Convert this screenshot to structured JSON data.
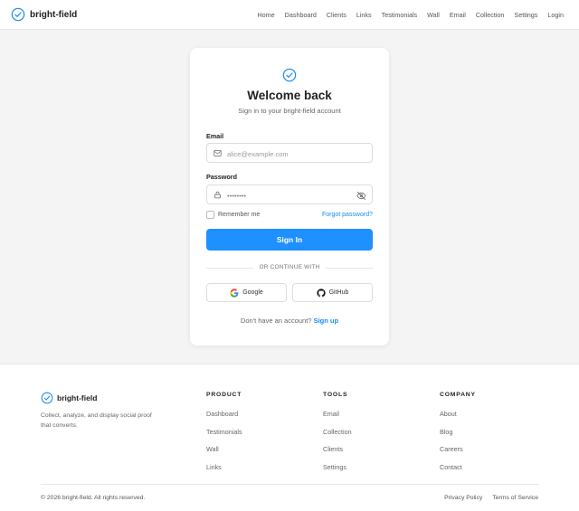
{
  "header": {
    "brand": "bright-field",
    "nav": [
      "Home",
      "Dashboard",
      "Clients",
      "Links",
      "Testimonials",
      "Wall",
      "Email",
      "Collection",
      "Settings",
      "Login"
    ]
  },
  "login": {
    "title": "Welcome back",
    "subtitle": "Sign in to your bright-field account",
    "email_label": "Email",
    "email_placeholder": "alice@example.com",
    "password_label": "Password",
    "password_value": "••••••••",
    "remember": "Remember me",
    "forgot": "Forgot password?",
    "submit": "Sign In",
    "divider": "OR CONTINUE WITH",
    "google": "Google",
    "github": "GitHub",
    "no_account": "Don't have an account?",
    "signup": "Sign up"
  },
  "footer": {
    "brand": "bright-field",
    "tagline": "Collect, analyze, and display social proof that converts.",
    "columns": [
      {
        "title": "PRODUCT",
        "links": [
          "Dashboard",
          "Testimonials",
          "Wall",
          "Links"
        ]
      },
      {
        "title": "TOOLS",
        "links": [
          "Email",
          "Collection",
          "Clients",
          "Settings"
        ]
      },
      {
        "title": "COMPANY",
        "links": [
          "About",
          "Blog",
          "Careers",
          "Contact"
        ]
      }
    ],
    "copyright": "© 2026 bright-field. All rights reserved.",
    "legal": [
      "Privacy Policy",
      "Terms of Service"
    ]
  },
  "colors": {
    "accent": "#1e90ff",
    "link": "#1a8cf0"
  },
  "icons": {
    "brand": "check-circle-icon",
    "email": "mail-icon",
    "password": "lock-icon",
    "toggle": "eye-off-icon",
    "google": "google-icon",
    "github": "github-icon"
  }
}
